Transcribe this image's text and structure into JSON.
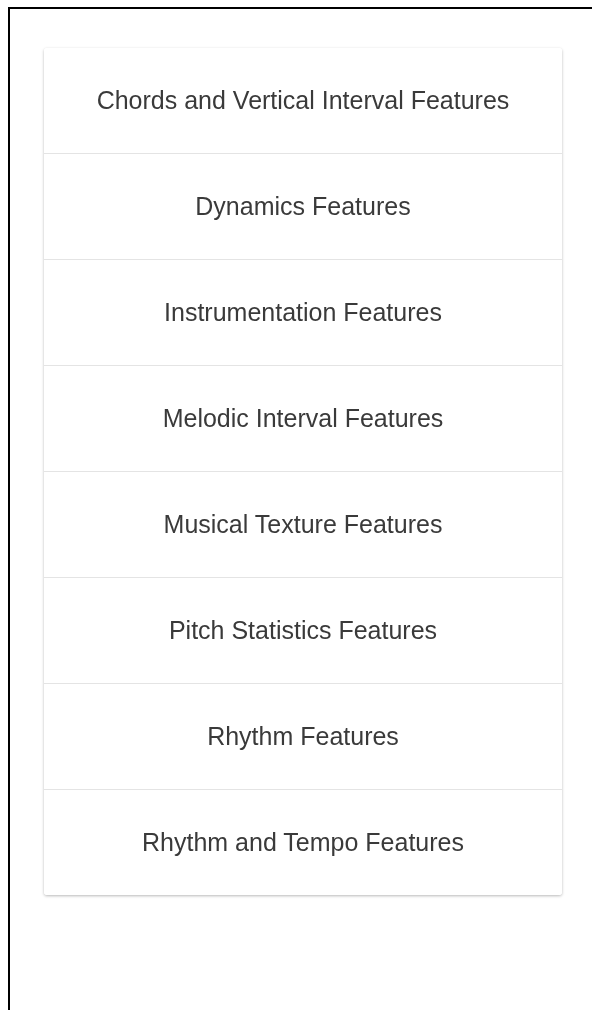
{
  "menu": {
    "items": [
      {
        "label": "Chords and Vertical Interval Features"
      },
      {
        "label": "Dynamics Features"
      },
      {
        "label": "Instrumentation Features"
      },
      {
        "label": "Melodic Interval Features"
      },
      {
        "label": "Musical Texture Features"
      },
      {
        "label": "Pitch Statistics Features"
      },
      {
        "label": "Rhythm Features"
      },
      {
        "label": "Rhythm and Tempo Features"
      }
    ]
  }
}
